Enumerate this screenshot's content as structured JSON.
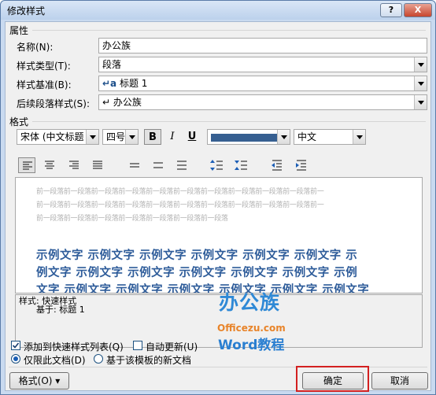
{
  "window": {
    "title": "修改样式",
    "help": "?",
    "close": "X"
  },
  "properties": {
    "section_label": "属性",
    "name_label": "名称(N):",
    "name_value": "办公族",
    "type_label": "样式类型(T):",
    "type_value": "段落",
    "based_label": "样式基准(B):",
    "based_value": "标题 1",
    "next_label": "后续段落样式(S):",
    "next_value": "办公族"
  },
  "format": {
    "section_label": "格式",
    "font": "宋体 (中文标题",
    "size": "四号",
    "bold": "B",
    "italic": "I",
    "underline": "U",
    "color": "#365f91",
    "script": "中文"
  },
  "preview": {
    "prev_lines": [
      "前一段落前一段落前一段落前一段落前一段落前一段落前一段落前一段落前一段落前一段落前一",
      "前一段落前一段落前一段落前一段落前一段落前一段落前一段落前一段落前一段落前一段落前一",
      "前一段落前一段落前一段落前一段落前一段落前一段落前一段落"
    ],
    "sample_lines": [
      "示例文字 示例文字 示例文字 示例文字 示例文字 示例文字 示",
      "例文字 示例文字 示例文字 示例文字 示例文字 示例文字 示例",
      "文字 示例文字 示例文字 示例文字 示例文字 示例文字 示例文字"
    ]
  },
  "description": {
    "line1": "样式: 快速样式",
    "line2": "基于: 标题 1"
  },
  "watermark": {
    "brand": "办公族",
    "domain": "Officezu.com",
    "tag": "Word教程"
  },
  "options": {
    "add_quick": "添加到快速样式列表(Q)",
    "auto_update": "自动更新(U)",
    "this_doc": "仅限此文档(D)",
    "template_doc": "基于该模板的新文档"
  },
  "buttons": {
    "format": "格式(O) ▾",
    "ok": "确定",
    "cancel": "取消"
  }
}
